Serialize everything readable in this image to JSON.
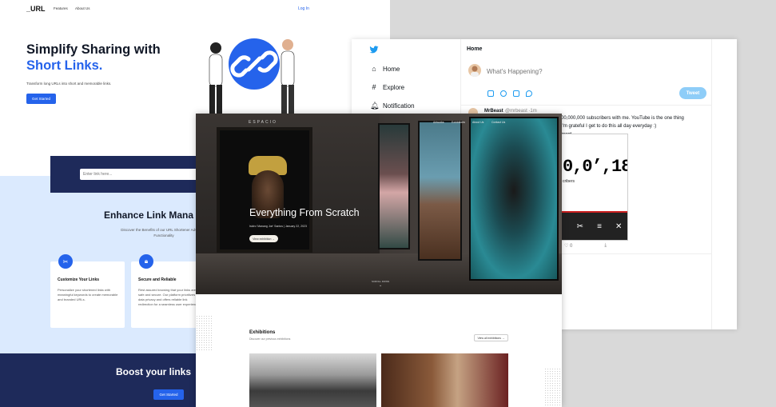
{
  "url_site": {
    "logo": "_URL",
    "nav": [
      "Features",
      "About Us"
    ],
    "login": "Log In",
    "hero_title_line1": "Simplify Sharing with",
    "hero_title_line2": "Short Links.",
    "hero_sub": "Transform long URLs into short and memorable links.",
    "cta": "Get Started",
    "search_placeholder": "Enter link here...",
    "section_title": "Enhance Link Mana",
    "section_sub": "Discover the Benefits of our URL Shortener Advanced Functionality",
    "cards": [
      {
        "title": "Customize Your Links",
        "body": "Personalize your shortened links with meaningful keywords to create memorable and branded URLs."
      },
      {
        "title": "Secure and Reliable",
        "body": "Rest assured knowing that your links are safe and secure. Our platform prioritizes data privacy and offers reliable link redirection for a seamless user experience."
      }
    ],
    "boost_title": "Boost your links",
    "boost_cta": "Get Started"
  },
  "twitter": {
    "nav": [
      {
        "label": "Home",
        "icon": "home-icon"
      },
      {
        "label": "Explore",
        "icon": "hashtag-icon"
      },
      {
        "label": "Notification",
        "icon": "bell-icon"
      }
    ],
    "header": "Home",
    "compose_placeholder": "What's Happening?",
    "tweet_button": "Tweet",
    "tweet": {
      "author": "MrBeast",
      "handle": "@mrbeast ·1m",
      "text_line1": "00,000,000 subscribers with me. YouTube is the one thing",
      "text_line2": " I'm grateful I get to do this all day everyday :)",
      "text_line3": "beast",
      "counter": "0,0’,18",
      "counter_label": "cribers",
      "likes": "0"
    },
    "accent": "#1d9bf0"
  },
  "gallery": {
    "logo": "ESPACIO",
    "nav": [
      "Artworks",
      "Exhibitions",
      "About Us",
      "Contact Us"
    ],
    "hero_title": "Everything From Scratch",
    "hero_meta": "Isidro 'Manang Joe' Santos | January 22, 2023",
    "view_button": "View exhibition",
    "scroll_label": "SCROLL DOWN",
    "section_title": "Exhibitions",
    "section_sub": "Discover our previous exhibitions",
    "view_all": "View all exhibitions"
  }
}
